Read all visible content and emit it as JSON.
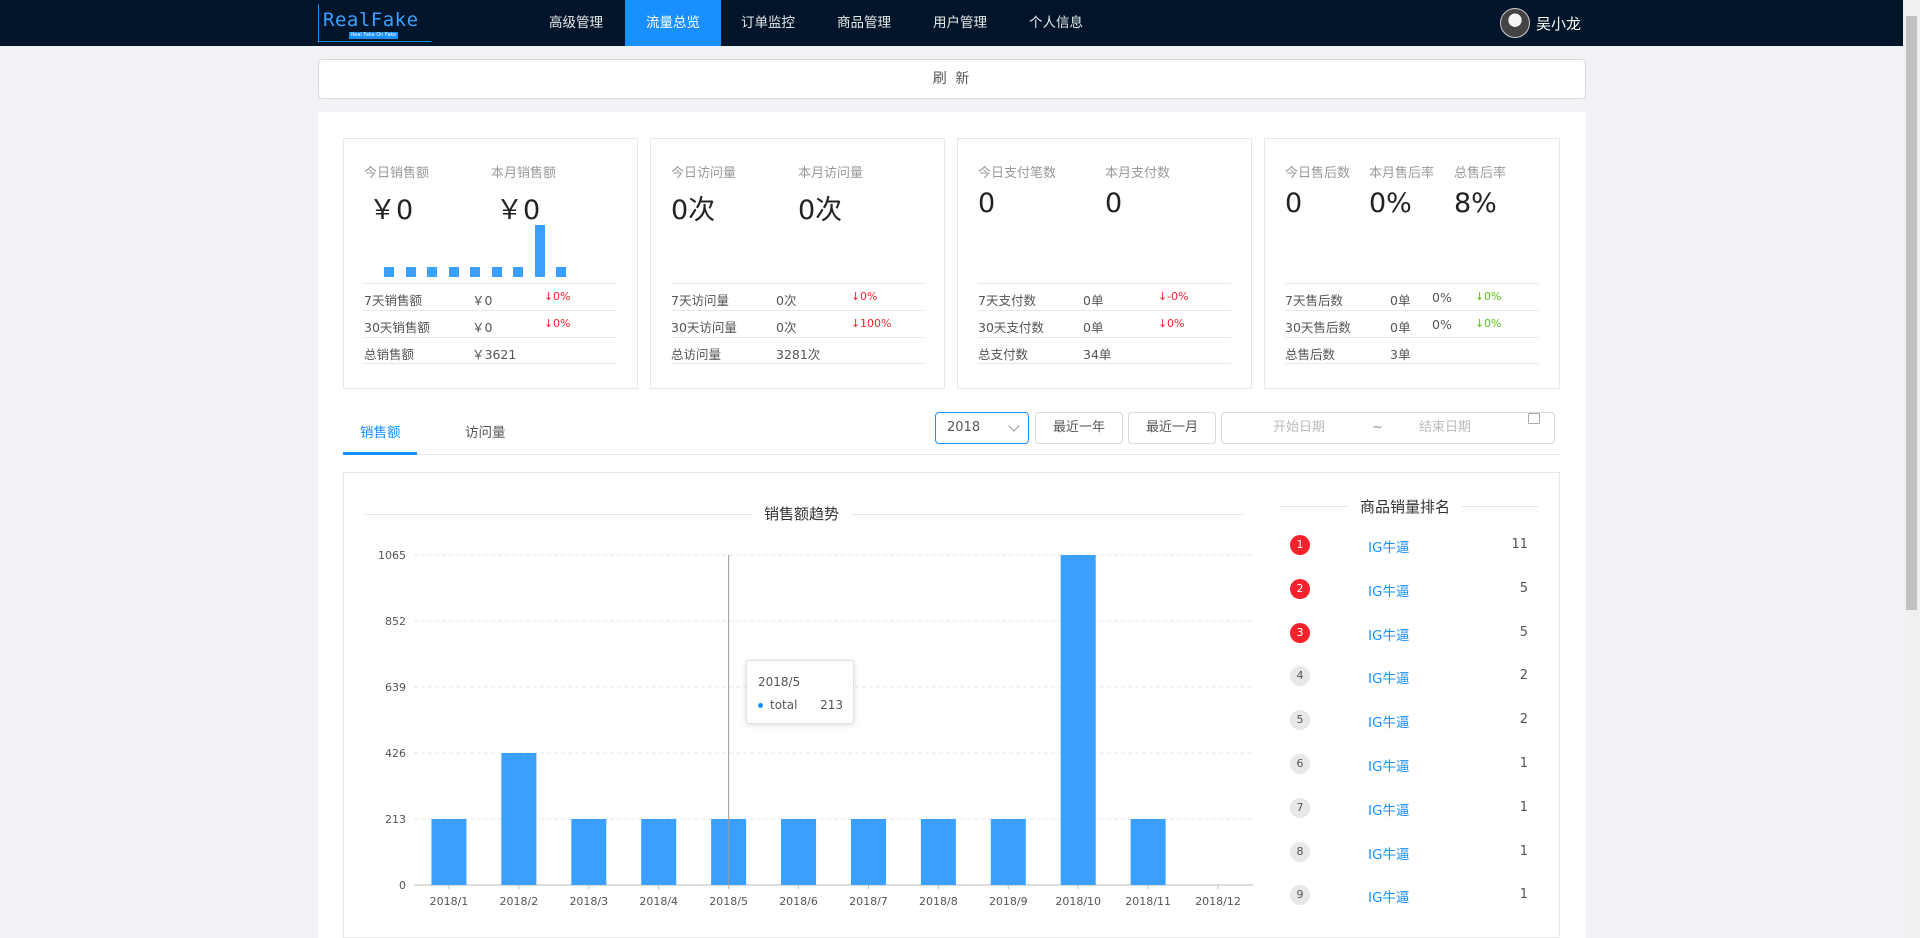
{
  "header": {
    "logo_text": "RealFake",
    "logo_subtitle": "Real Fake On Fake",
    "nav": [
      "高级管理",
      "流量总览",
      "订单监控",
      "商品管理",
      "用户管理",
      "个人信息"
    ],
    "active_nav": "流量总览",
    "username": "吴小龙"
  },
  "refresh_label": "刷 新",
  "cards": [
    {
      "labels": [
        "今日销售额",
        "本月销售额"
      ],
      "values": [
        "￥0",
        "￥0"
      ],
      "mini_bars": [
        0.19,
        0.19,
        0.19,
        0.19,
        0.19,
        0.19,
        0.19,
        1.0,
        0.19
      ],
      "rows": [
        {
          "label": "7天销售额",
          "value": "￥0",
          "delta": "0%",
          "dir": "down"
        },
        {
          "label": "30天销售额",
          "value": "￥0",
          "delta": "0%",
          "dir": "down"
        },
        {
          "label": "总销售额",
          "value": "￥3621",
          "delta": "",
          "dir": ""
        }
      ]
    },
    {
      "labels": [
        "今日访问量",
        "本月访问量"
      ],
      "values": [
        "0次",
        "0次"
      ],
      "rows": [
        {
          "label": "7天访问量",
          "value": "0次",
          "delta": "0%",
          "dir": "down"
        },
        {
          "label": "30天访问量",
          "value": "0次",
          "delta": "100%",
          "dir": "down"
        },
        {
          "label": "总访问量",
          "value": "3281次",
          "delta": "",
          "dir": ""
        }
      ]
    },
    {
      "labels": [
        "今日支付笔数",
        "本月支付数"
      ],
      "values": [
        "0",
        "0"
      ],
      "rows": [
        {
          "label": "7天支付数",
          "value": "0单",
          "delta": "-0%",
          "dir": "down"
        },
        {
          "label": "30天支付数",
          "value": "0单",
          "delta": "0%",
          "dir": "down"
        },
        {
          "label": "总支付数",
          "value": "34单",
          "delta": "",
          "dir": ""
        }
      ]
    },
    {
      "labels": [
        "今日售后数",
        "本月售后率",
        "总售后率"
      ],
      "values": [
        "0",
        "0%",
        "8%"
      ],
      "rows": [
        {
          "label": "7天售后数",
          "value": "0单",
          "extra": "0%",
          "delta": "0%",
          "dir": "up"
        },
        {
          "label": "30天售后数",
          "value": "0单",
          "extra": "0%",
          "delta": "0%",
          "dir": "up"
        },
        {
          "label": "总售后数",
          "value": "3单",
          "extra": "",
          "delta": "",
          "dir": ""
        }
      ]
    }
  ],
  "tabs": [
    "销售额",
    "访问量"
  ],
  "active_tab": "销售额",
  "filters": {
    "year": "2018",
    "last_year": "最近一年",
    "last_month": "最近一月",
    "start_placeholder": "开始日期",
    "separator": "~",
    "end_placeholder": "结束日期"
  },
  "chart_data": {
    "type": "bar",
    "title": "销售额趋势",
    "categories": [
      "2018/1",
      "2018/2",
      "2018/3",
      "2018/4",
      "2018/5",
      "2018/6",
      "2018/7",
      "2018/8",
      "2018/9",
      "2018/10",
      "2018/11",
      "2018/12"
    ],
    "series": [
      {
        "name": "total",
        "values": [
          213,
          426,
          213,
          213,
          213,
          213,
          213,
          213,
          213,
          1065,
          213,
          0
        ]
      }
    ],
    "yticks": [
      0,
      213,
      426,
      639,
      852,
      1065
    ],
    "ylim": [
      0,
      1065
    ],
    "grid": true,
    "bar_color": "#3aa0ff",
    "tooltip": {
      "title": "2018/5",
      "name": "total",
      "value": "213"
    }
  },
  "ranking": {
    "title": "商品销量排名",
    "items": [
      {
        "rank": "1",
        "name": "IG牛逼",
        "value": "11"
      },
      {
        "rank": "2",
        "name": "IG牛逼",
        "value": "5"
      },
      {
        "rank": "3",
        "name": "IG牛逼",
        "value": "5"
      },
      {
        "rank": "4",
        "name": "IG牛逼",
        "value": "2"
      },
      {
        "rank": "5",
        "name": "IG牛逼",
        "value": "2"
      },
      {
        "rank": "6",
        "name": "IG牛逼",
        "value": "1"
      },
      {
        "rank": "7",
        "name": "IG牛逼",
        "value": "1"
      },
      {
        "rank": "8",
        "name": "IG牛逼",
        "value": "1"
      },
      {
        "rank": "9",
        "name": "IG牛逼",
        "value": "1"
      }
    ]
  },
  "colors": {
    "primary": "#1890ff",
    "header": "#001529",
    "down": "#f5222d",
    "up": "#52c41a"
  }
}
